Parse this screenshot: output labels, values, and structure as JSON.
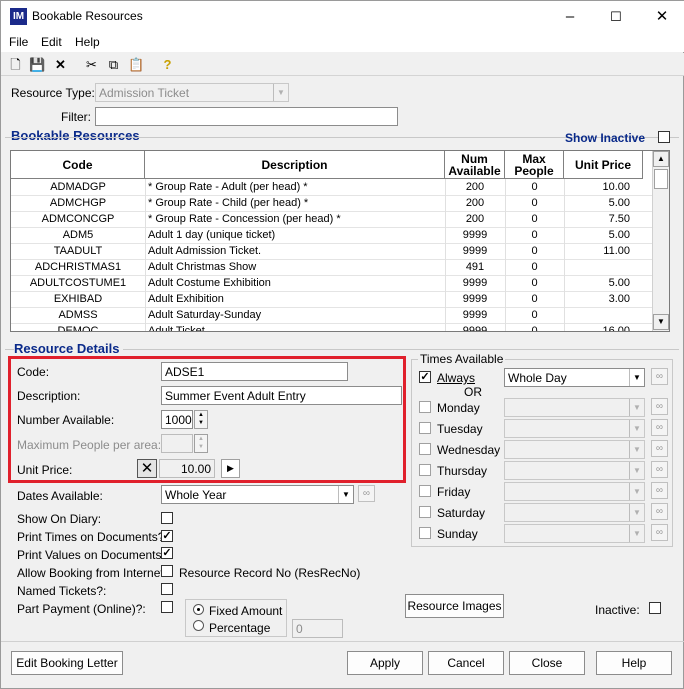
{
  "window": {
    "title": "Bookable Resources",
    "icon_text": "IM",
    "minimize": "–",
    "maximize": "☐",
    "close": "✕"
  },
  "menu": {
    "file": "File",
    "edit": "Edit",
    "help": "Help"
  },
  "toolbar": {
    "icons": [
      "new-doc-icon",
      "save-icon",
      "delete-icon",
      "cut-icon",
      "copy-icon",
      "paste-icon",
      "help-icon"
    ]
  },
  "filters": {
    "resource_type_label": "Resource Type:",
    "resource_type_value": "Admission Ticket",
    "filter_label": "Filter:",
    "filter_value": ""
  },
  "bookable": {
    "section_title": "Bookable Resources",
    "show_inactive_label": "Show Inactive",
    "columns": [
      "Code",
      "Description",
      "Num Available",
      "Max People",
      "Unit Price"
    ],
    "rows": [
      {
        "code": "ADMADGP",
        "desc": "* Group Rate - Adult (per head) *",
        "num": "200",
        "max": "0",
        "price": "10.00"
      },
      {
        "code": "ADMCHGP",
        "desc": "* Group Rate - Child (per head) *",
        "num": "200",
        "max": "0",
        "price": "5.00"
      },
      {
        "code": "ADMCONCGP",
        "desc": "* Group Rate - Concession (per head) *",
        "num": "200",
        "max": "0",
        "price": "7.50"
      },
      {
        "code": "ADM5",
        "desc": "Adult 1 day (unique ticket)",
        "num": "9999",
        "max": "0",
        "price": "5.00"
      },
      {
        "code": "TAADULT",
        "desc": "Adult Admission Ticket.",
        "num": "9999",
        "max": "0",
        "price": "11.00"
      },
      {
        "code": "ADCHRISTMAS1",
        "desc": "Adult Christmas Show",
        "num": "491",
        "max": "0",
        "price": ""
      },
      {
        "code": "ADULTCOSTUME1",
        "desc": "Adult Costume Exhibition",
        "num": "9999",
        "max": "0",
        "price": "5.00"
      },
      {
        "code": "EXHIBAD",
        "desc": "Adult Exhibition",
        "num": "9999",
        "max": "0",
        "price": "3.00"
      },
      {
        "code": "ADMSS",
        "desc": "Adult Saturday-Sunday",
        "num": "9999",
        "max": "0",
        "price": ""
      },
      {
        "code": "DEMOC",
        "desc": "Adult Ticket",
        "num": "9999",
        "max": "0",
        "price": "16.00"
      }
    ]
  },
  "details": {
    "section_title": "Resource Details",
    "code_label": "Code:",
    "code_value": "ADSE1",
    "description_label": "Description:",
    "description_value": "Summer Event Adult Entry",
    "number_label": "Number Available:",
    "number_value": "1000",
    "max_people_label": "Maximum People per area:",
    "max_people_value": "",
    "unit_price_label": "Unit Price:",
    "unit_price_value": "10.00",
    "dates_label": "Dates Available:",
    "dates_value": "Whole Year",
    "show_on_diary_label": "Show On Diary:",
    "print_times_label": "Print Times on Documents?:",
    "print_values_label": "Print Values on Documents?:",
    "allow_internet_label": "Allow Booking from Internet:",
    "resrecno_label": "Resource Record No (ResRecNo)",
    "named_tickets_label": "Named Tickets?:",
    "part_payment_label": "Part Payment (Online)?:",
    "fixed_amount_label": "Fixed Amount",
    "percentage_label": "Percentage",
    "percentage_value": "0",
    "resource_images_label": "Resource Images",
    "inactive_label": "Inactive:"
  },
  "times": {
    "title": "Times Available",
    "always_label": "Always",
    "always_value": "Whole Day",
    "or_label": "OR",
    "days": [
      "Monday",
      "Tuesday",
      "Wednesday",
      "Thursday",
      "Friday",
      "Saturday",
      "Sunday"
    ]
  },
  "buttons": {
    "edit_letter": "Edit Booking Letter",
    "apply": "Apply",
    "cancel": "Cancel",
    "close": "Close",
    "help": "Help"
  }
}
